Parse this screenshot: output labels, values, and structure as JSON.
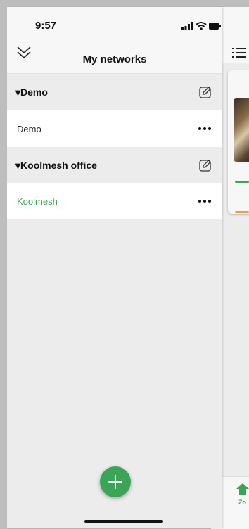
{
  "status_bar": {
    "time": "9:57",
    "icons": [
      "signal-icon",
      "wifi-icon",
      "battery-icon"
    ]
  },
  "header": {
    "title": "My networks",
    "collapse_icon": "double-chevron-down-icon"
  },
  "groups": [
    {
      "name": "Demo",
      "expanded": true,
      "items": [
        {
          "label": "Demo",
          "active": false
        }
      ]
    },
    {
      "name": "Koolmesh office",
      "expanded": true,
      "items": [
        {
          "label": "Koolmesh",
          "active": true
        }
      ]
    }
  ],
  "group_prefix": "▾",
  "fab": {
    "icon": "plus-icon"
  },
  "background_app": {
    "nav_label": "Zo"
  },
  "colors": {
    "accent_green": "#3aa655",
    "accent_orange": "#f09a3e",
    "sheet_bg": "#ececec",
    "row_bg": "#ffffff"
  }
}
